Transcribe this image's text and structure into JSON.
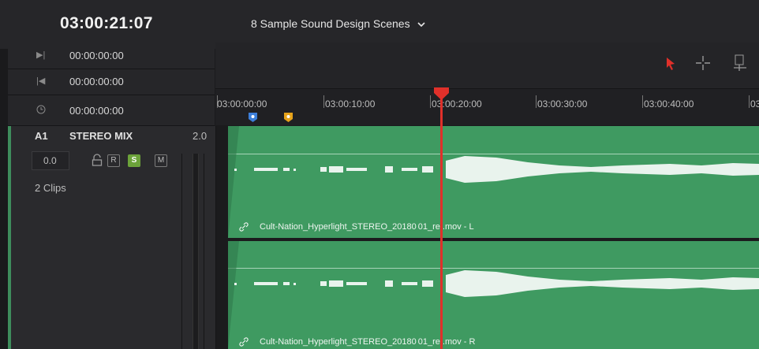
{
  "header": {
    "timecode": "03:00:21:07",
    "timeline_name": "8 Sample Sound Design Scenes",
    "timeline_dropdown_icon": "chevron-down-icon"
  },
  "timecodes": {
    "in_point": "00:00:00:00",
    "out_point": "00:00:00:00",
    "duration": "00:00:00:00"
  },
  "toolbar": {
    "tools": [
      "selection-arrow-icon",
      "crosshair-icon",
      "blade-icon"
    ],
    "accent": "#e0302a"
  },
  "ruler": {
    "labels": [
      "03:00:00:00",
      "03:00:10:00",
      "03:",
      "00:20:00",
      "03:00:30:00",
      "03:00:40:00",
      "03:"
    ],
    "markers": [
      {
        "icon": "blue-marker-icon",
        "color": "#3d7fd9"
      },
      {
        "icon": "yellow-marker-icon",
        "color": "#e6a21a"
      }
    ]
  },
  "track": {
    "id": "A1",
    "name": "STEREO MIX",
    "format": "2.0",
    "volume": "0.0",
    "buttons": {
      "record": "R",
      "solo": "S",
      "mute": "M"
    },
    "clip_count": "2 Clips"
  },
  "clips": [
    {
      "label": "Cult-Nation_Hyperlight_STEREO_20180",
      "label_tail": "01_ref.mov - L",
      "color": "#3f9a61"
    },
    {
      "label": "Cult-Nation_Hyperlight_STEREO_20180",
      "label_tail": "01_ref.mov - R",
      "color": "#3f9a61"
    }
  ]
}
